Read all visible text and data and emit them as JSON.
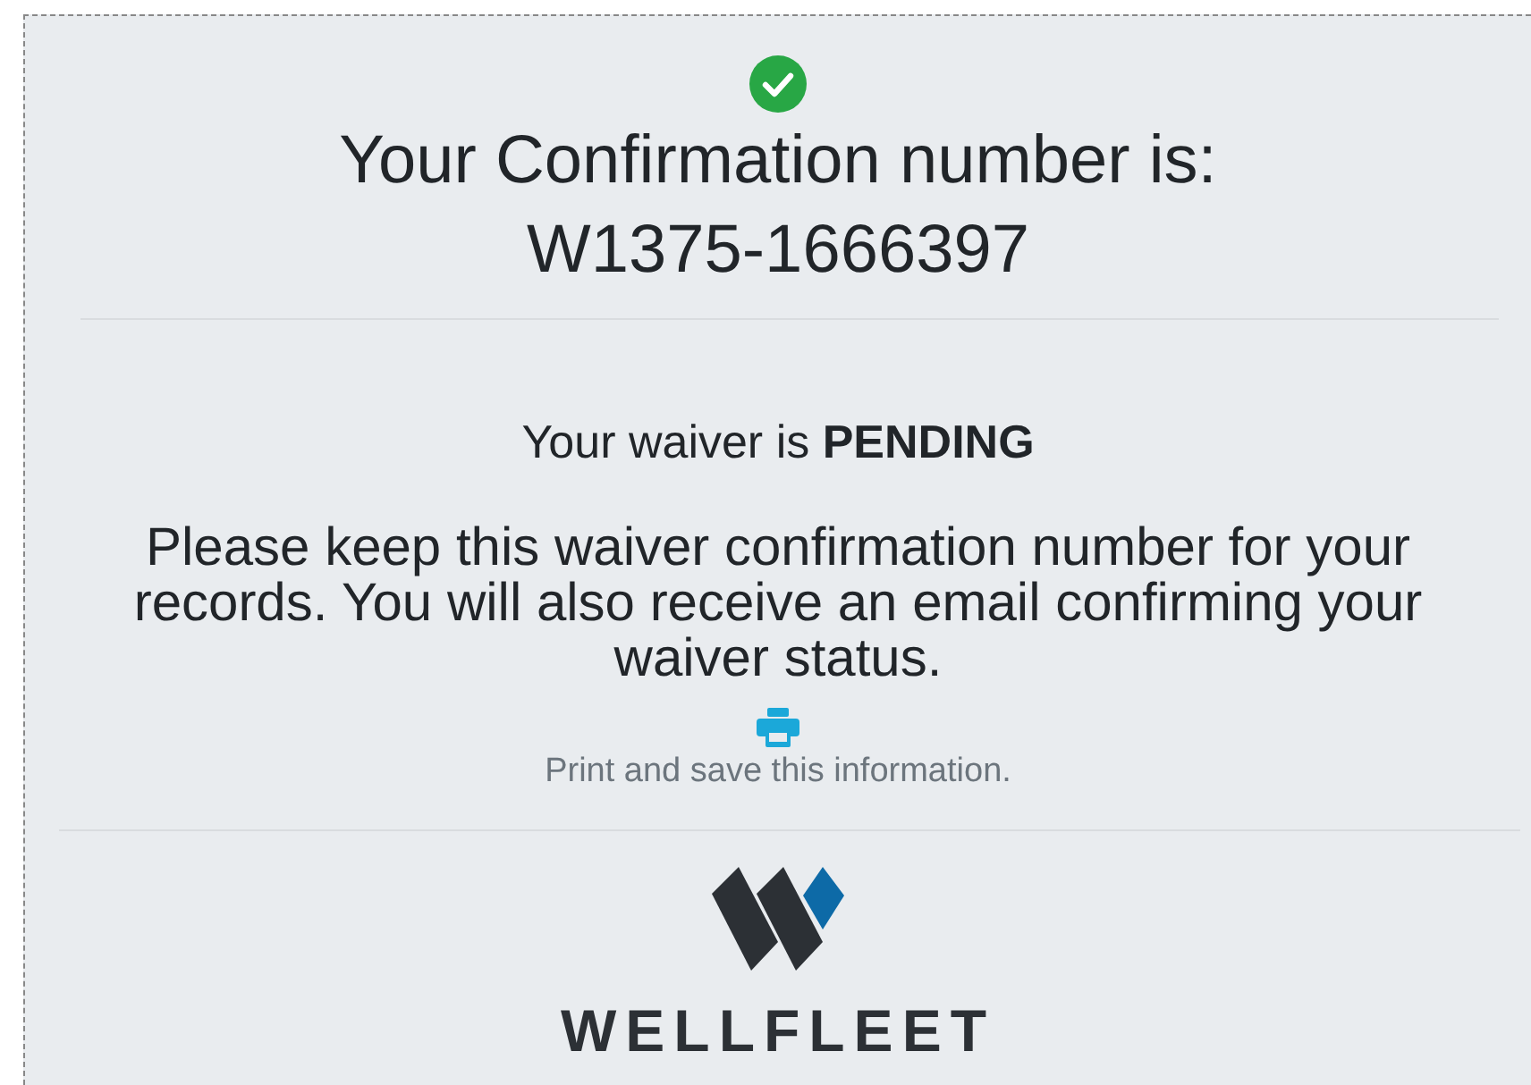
{
  "confirmation": {
    "heading": "Your Confirmation number is:",
    "number": "W1375-1666397"
  },
  "waiver": {
    "status_line": "Your waiver is **PENDING**",
    "message": "Please keep this waiver confirmation number for your records. You will also receive an email confirming your waiver status.",
    "print_link": "Print and save this information."
  },
  "logo": {
    "wordmark": "WELLFLEET"
  }
}
